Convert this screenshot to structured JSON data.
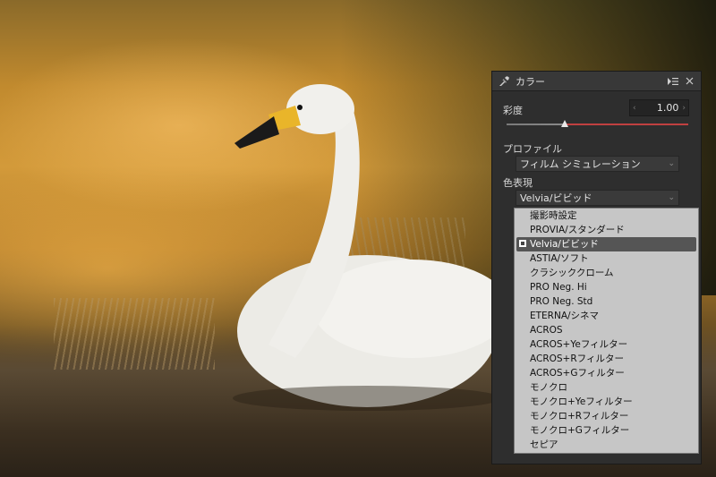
{
  "panel": {
    "title": "カラー",
    "saturation": {
      "label": "彩度",
      "value": "1.00",
      "slider_position": 0.32
    },
    "profile": {
      "label": "プロファイル",
      "value": "フィルム シミュレーション"
    },
    "color_rendition": {
      "label": "色表現",
      "value": "Velvia/ビビッド"
    },
    "dropdown_options": [
      "撮影時設定",
      "PROVIA/スタンダード",
      "Velvia/ビビッド",
      "ASTIA/ソフト",
      "クラシッククローム",
      "PRO Neg. Hi",
      "PRO Neg. Std",
      "ETERNA/シネマ",
      "ACROS",
      "ACROS+Yeフィルター",
      "ACROS+Rフィルター",
      "ACROS+Gフィルター",
      "モノクロ",
      "モノクロ+Yeフィルター",
      "モノクロ+Rフィルター",
      "モノクロ+Gフィルター",
      "セピア"
    ],
    "selected_option": "Velvia/ビビッド"
  },
  "icons": {
    "tool": "dropper-icon",
    "menu": "panel-menu-icon",
    "close": "close-icon",
    "chevron": "chevron-down-icon"
  },
  "colors": {
    "accent_red": "#c04040",
    "panel_bg": "#2e2e2e",
    "dropdown_bg": "#c6c6c6",
    "selected_bg": "#555555"
  }
}
